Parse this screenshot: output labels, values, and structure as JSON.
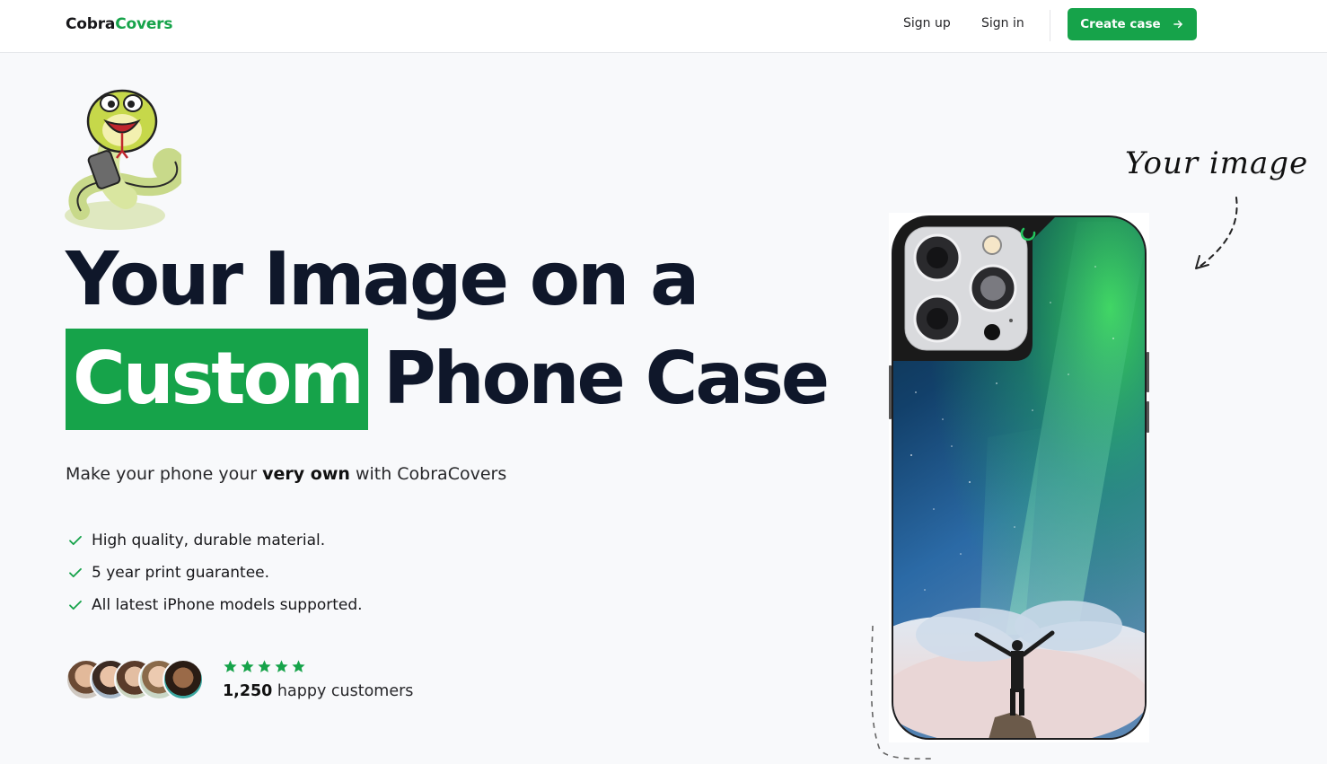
{
  "nav": {
    "brand_part1": "Cobra",
    "brand_part2": "Covers",
    "sign_up": "Sign up",
    "sign_in": "Sign in",
    "create_case": "Create case",
    "create_case_icon": "arrow-right-icon"
  },
  "hero": {
    "headline_line1": "Your Image on a",
    "headline_highlight": "Custom",
    "headline_line2": "Phone Case",
    "subtitle_pre": "Make your phone your ",
    "subtitle_bold": "very own",
    "subtitle_post": " with CobraCovers",
    "features": [
      "High quality, durable material.",
      "5 year print guarantee.",
      "All latest iPhone models supported."
    ],
    "feature_icon": "check-icon",
    "rating_stars": 5,
    "customer_count": "1,250",
    "customer_label": " happy customers"
  },
  "showcase": {
    "annotation": "Your image"
  },
  "colors": {
    "accent": "#16a34a",
    "text_dark": "#0f172a",
    "background": "#f8f9fb"
  }
}
